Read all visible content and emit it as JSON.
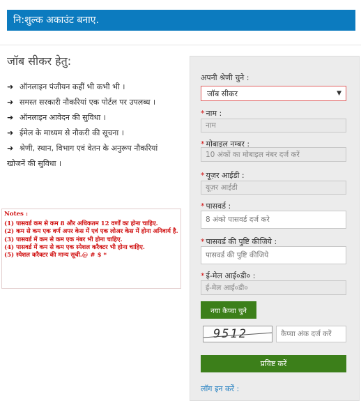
{
  "header": {
    "title": "नि:शुल्क अकाउंट बनाए."
  },
  "left": {
    "title": "जॉब सीकर हेतु:",
    "features": [
      "ऑनलाइन पंजीयन कहीं भी कभी भी ।",
      "समस्त सरकारी नौकरियां एक पोर्टल पर उपलब्ध ।",
      "ऑनलाइन आवेदन की सुविधा ।",
      "ईमेल के माध्यम से नौकरी की सूचना ।",
      "श्रेणी, स्थान, विभाग एवं वेतन के अनुरूप नौकरियां",
      "खोजनें की सुविधा ।"
    ]
  },
  "notes": {
    "title": "Notes :",
    "items": [
      "(1) पासवर्ड कम से कम 8 और अधिकतम 12 वर्णों का होना चाहिए.",
      "(2) कम से कम एक वर्ण अपर केस में एवं एक लोअर केस में होना अनिवार्य है.",
      "(3) पासवर्ड में कम से कम एक नंबर भी होना चाहिए.",
      "(4) पासवर्ड में कम से कम एक स्पेशल करैक्टर भी होना चाहिए.",
      "(5) स्पेशल करैक्टर की मान्य सूची.@ # $ *"
    ]
  },
  "form": {
    "category_label": "अपनी श्रेणी चुने :",
    "category_value": "जॉब सीकर",
    "name_label": "नाम :",
    "name_placeholder": "नाम",
    "mobile_label": "मोबाइल नम्बर :",
    "mobile_placeholder": "10 अंकों का मोबाइल नंबर दर्ज करें",
    "userid_label": "यूज़र आईडी :",
    "userid_placeholder": "यूज़र आईडी",
    "password_label": "पासवर्ड :",
    "password_placeholder": "8 अंको पासवर्ड दर्ज करे",
    "confirm_label": "पासवर्ड की पुष्टि कीजिये :",
    "confirm_placeholder": "पासवर्ड की पुष्टि कीजिये",
    "email_label": "ई-मेल आई०डी० :",
    "email_placeholder": "ई-मेल आई०डी०",
    "new_captcha_label": "नया कैप्चा चुने",
    "captcha_text": "9512",
    "captcha_placeholder": "कैप्चा अंक दर्ज करें",
    "submit_label": "प्रविष्ट करें",
    "login_link": "लॉग इन करें :"
  },
  "colors": {
    "header": "#0c7bbf",
    "button": "#3c7f1a",
    "required": "#d01010"
  }
}
